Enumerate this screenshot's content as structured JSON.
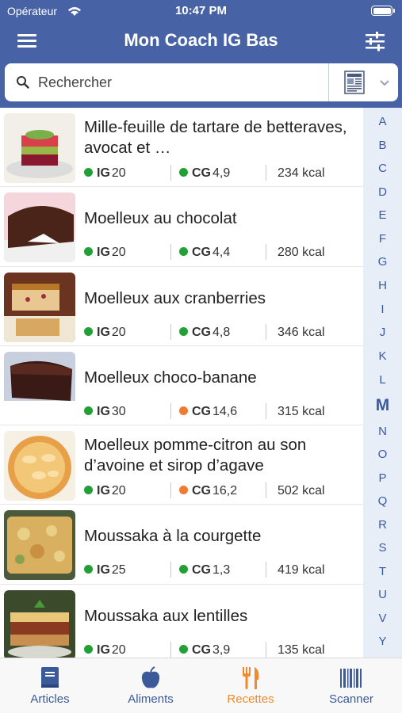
{
  "status_bar": {
    "carrier": "Opérateur",
    "time": "10:47 PM"
  },
  "header": {
    "title": "Mon Coach IG Bas"
  },
  "search": {
    "placeholder": "Rechercher"
  },
  "recipes": [
    {
      "title": "Mille-feuille de tartare de betteraves, avocat et …",
      "ig_label": "IG",
      "ig": "20",
      "ig_color": "green",
      "cg_label": "CG",
      "cg": "4,9",
      "cg_color": "green",
      "kcal": "234 kcal"
    },
    {
      "title": "Moelleux au chocolat",
      "ig_label": "IG",
      "ig": "20",
      "ig_color": "green",
      "cg_label": "CG",
      "cg": "4,4",
      "cg_color": "green",
      "kcal": "280 kcal"
    },
    {
      "title": "Moelleux aux cranberries",
      "ig_label": "IG",
      "ig": "20",
      "ig_color": "green",
      "cg_label": "CG",
      "cg": "4,8",
      "cg_color": "green",
      "kcal": "346 kcal"
    },
    {
      "title": "Moelleux choco-banane",
      "ig_label": "IG",
      "ig": "30",
      "ig_color": "green",
      "cg_label": "CG",
      "cg": "14,6",
      "cg_color": "orange",
      "kcal": "315 kcal"
    },
    {
      "title": "Moelleux pomme-citron au son d’avoine et sirop d’agave",
      "ig_label": "IG",
      "ig": "20",
      "ig_color": "green",
      "cg_label": "CG",
      "cg": "16,2",
      "cg_color": "orange",
      "kcal": "502 kcal"
    },
    {
      "title": "Moussaka à la courgette",
      "ig_label": "IG",
      "ig": "25",
      "ig_color": "green",
      "cg_label": "CG",
      "cg": "1,3",
      "cg_color": "green",
      "kcal": "419 kcal"
    },
    {
      "title": "Moussaka aux lentilles",
      "ig_label": "IG",
      "ig": "20",
      "ig_color": "green",
      "cg_label": "CG",
      "cg": "3,9",
      "cg_color": "green",
      "kcal": "135 kcal"
    }
  ],
  "alpha_index": {
    "letters": [
      "A",
      "B",
      "C",
      "D",
      "E",
      "F",
      "G",
      "H",
      "I",
      "J",
      "K",
      "L",
      "M",
      "N",
      "O",
      "P",
      "Q",
      "R",
      "S",
      "T",
      "U",
      "V",
      "Y"
    ],
    "active": "M"
  },
  "tabs": [
    {
      "label": "Articles",
      "icon": "book-icon"
    },
    {
      "label": "Aliments",
      "icon": "apple-icon"
    },
    {
      "label": "Recettes",
      "icon": "fork-knife-icon",
      "active": true
    },
    {
      "label": "Scanner",
      "icon": "barcode-icon"
    }
  ],
  "colors": {
    "header": "#4763a6",
    "accent_active": "#f08a2a",
    "tab_inactive": "#3b5a99",
    "dot_green": "#22a036",
    "dot_orange": "#f07a32",
    "index_bg": "#e8eef8"
  }
}
